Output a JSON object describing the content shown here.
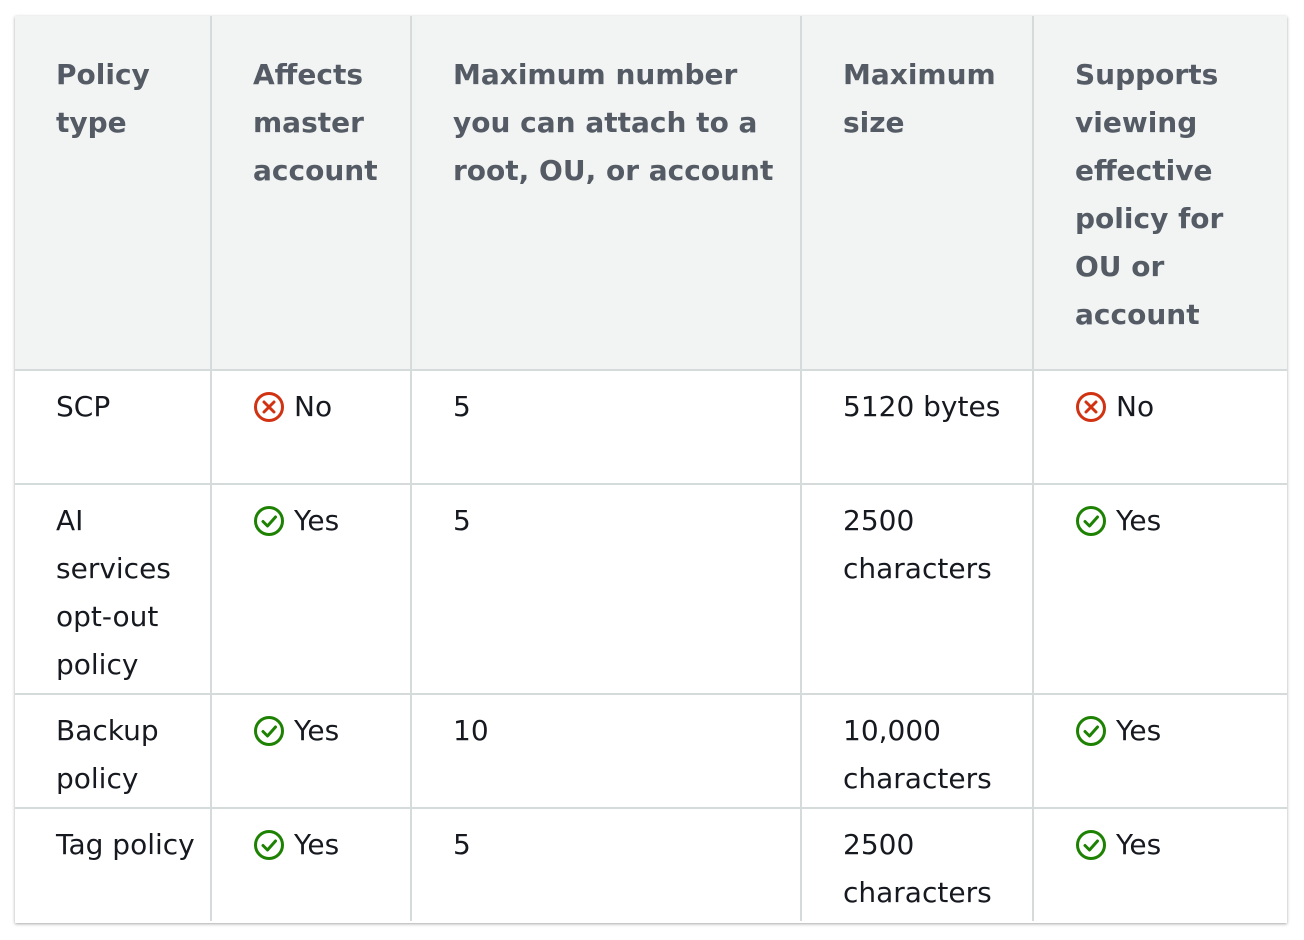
{
  "table": {
    "headers": [
      "Policy type",
      "Affects master account",
      "Maximum number you can attach to a root, OU, or account",
      "Maximum size",
      "Supports viewing effective policy for OU or account"
    ],
    "rows": [
      {
        "policy_type": "SCP",
        "affects_master": {
          "label": "No",
          "icon": "x-circle-icon"
        },
        "max_attach": "5",
        "max_size": "5120 bytes",
        "effective_view": {
          "label": "No",
          "icon": "x-circle-icon"
        }
      },
      {
        "policy_type": "AI services opt-out policy",
        "affects_master": {
          "label": "Yes",
          "icon": "check-circle-icon"
        },
        "max_attach": "5",
        "max_size": "2500 characters",
        "effective_view": {
          "label": "Yes",
          "icon": "check-circle-icon"
        }
      },
      {
        "policy_type": "Backup policy",
        "affects_master": {
          "label": "Yes",
          "icon": "check-circle-icon"
        },
        "max_attach": "10",
        "max_size": "10,000 characters",
        "effective_view": {
          "label": "Yes",
          "icon": "check-circle-icon"
        }
      },
      {
        "policy_type": "Tag policy",
        "affects_master": {
          "label": "Yes",
          "icon": "check-circle-icon"
        },
        "max_attach": "5",
        "max_size": "2500 characters",
        "effective_view": {
          "label": "Yes",
          "icon": "check-circle-icon"
        }
      }
    ]
  },
  "colors": {
    "header_bg": "#f2f3f3",
    "header_text": "#545b64",
    "no_red": "#d13212",
    "yes_green": "#1d8102",
    "border": "#d5dbdb"
  }
}
